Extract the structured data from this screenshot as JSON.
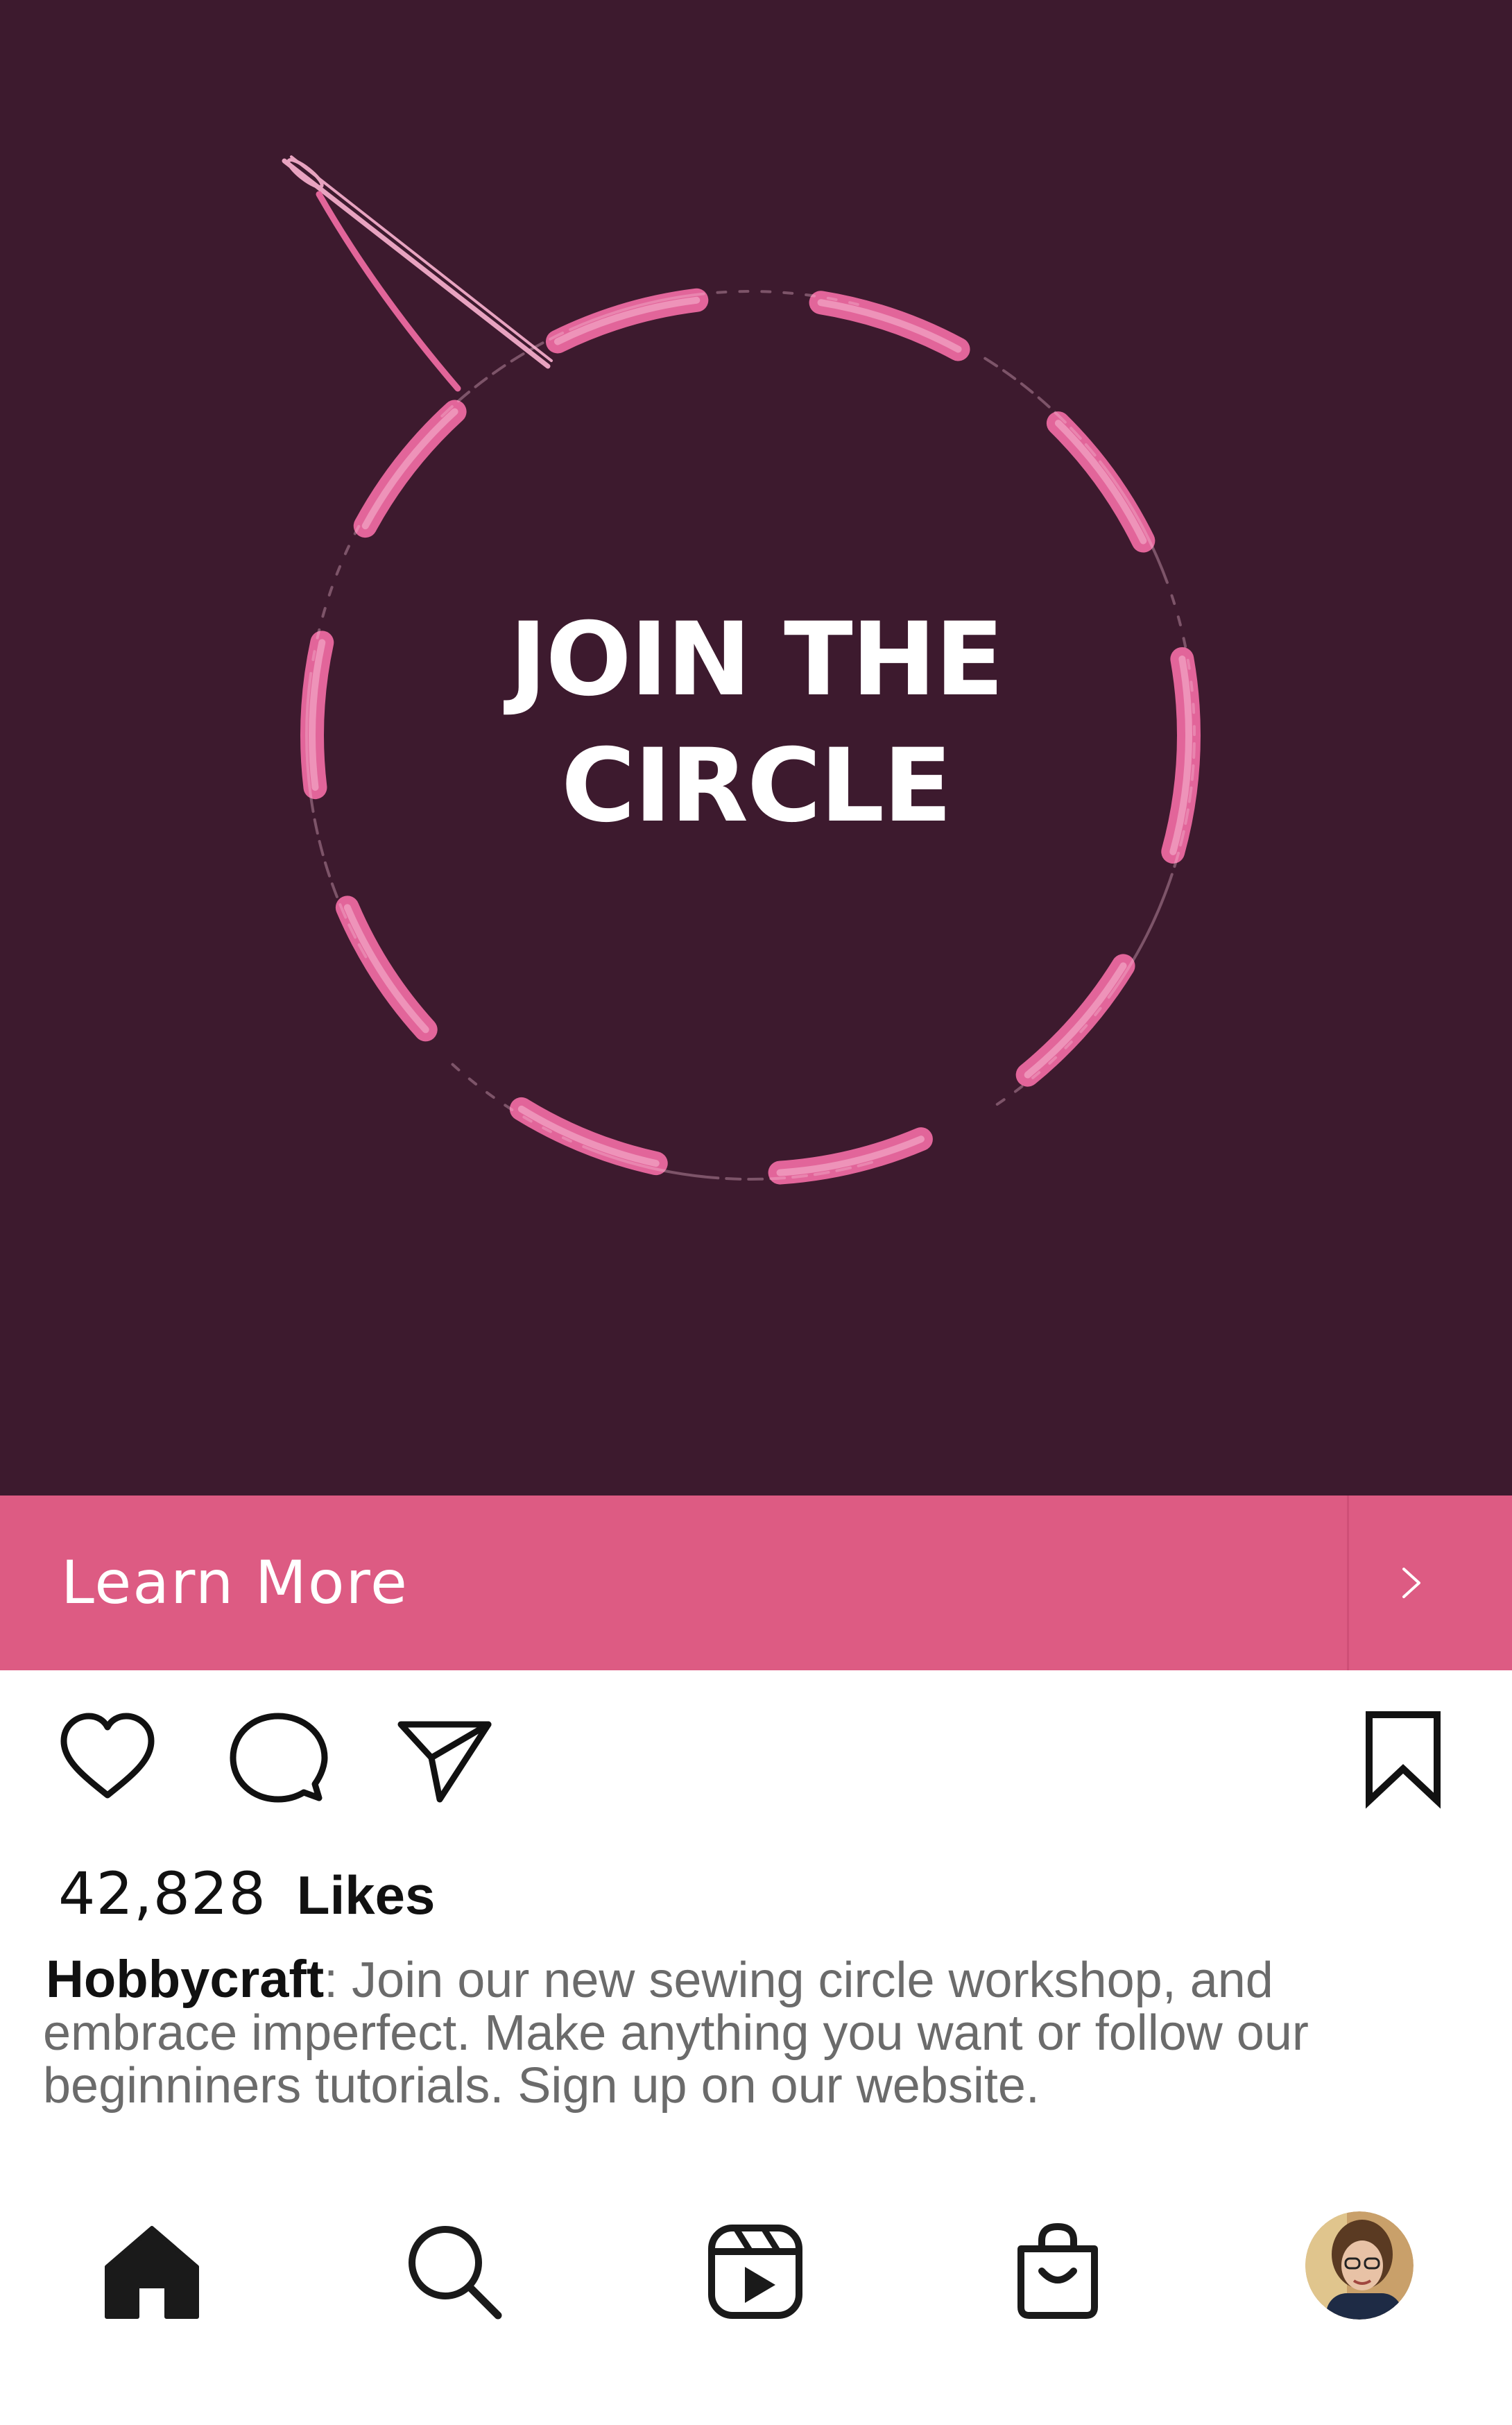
{
  "post": {
    "headline_line1": "JOIN THE",
    "headline_line2": "CIRCLE",
    "cta_label": "Learn More"
  },
  "engagement": {
    "likes_count": "42,828",
    "likes_label": "Likes"
  },
  "caption": {
    "username": "Hobbycraft",
    "text": ": Join our new sewing circle workshop, and embrace imperfect. Make anything you want or follow our beginniners tutorials. Sign up on our website."
  },
  "icons": {
    "like": "heart-icon",
    "comment": "comment-icon",
    "share": "send-icon",
    "save": "bookmark-icon",
    "cta": "chevron-right-icon",
    "nav_home": "home-icon",
    "nav_search": "search-icon",
    "nav_reels": "reels-icon",
    "nav_shop": "shop-bag-icon",
    "nav_profile": "profile-avatar"
  },
  "colors": {
    "hero_background": "#3d1a2e",
    "stitch_pink": "#e2659a",
    "cta_background": "#dd5b83",
    "text_dark": "#111111",
    "caption_grey": "#6b6b6b"
  }
}
